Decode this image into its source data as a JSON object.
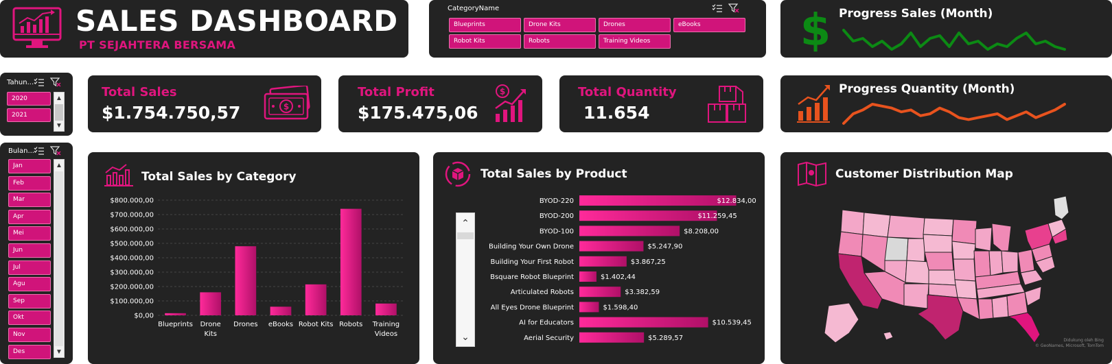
{
  "header": {
    "title": "SALES DASHBOARD",
    "subtitle": "PT SEJAHTERA BERSAMA"
  },
  "category_slicer": {
    "title": "CategoryName",
    "items": [
      "Blueprints",
      "Drone Kits",
      "Drones",
      "eBooks",
      "Robot Kits",
      "Robots",
      "Training Videos"
    ]
  },
  "year_slicer": {
    "title": "Tahun...",
    "items": [
      "2020",
      "2021"
    ]
  },
  "month_slicer": {
    "title": "Bulan...",
    "items": [
      "Jan",
      "Feb",
      "Mar",
      "Apr",
      "Mei",
      "Jun",
      "Jul",
      "Agu",
      "Sep",
      "Okt",
      "Nov",
      "Des"
    ]
  },
  "kpis": {
    "total_sales": {
      "label": "Total Sales",
      "value": "$1.754.750,57"
    },
    "total_profit": {
      "label": "Total Profit",
      "value": "$175.475,06"
    },
    "total_quantity": {
      "label": "Total Quantity",
      "value": "11.654"
    }
  },
  "progress_sales": {
    "title": "Progress Sales (Month)",
    "color": "#0c8a14",
    "values": [
      10,
      6,
      7,
      4,
      6,
      3,
      5,
      9,
      4,
      7,
      8,
      4,
      9,
      5,
      6,
      3,
      5,
      4,
      7,
      9,
      5,
      6,
      4,
      3
    ]
  },
  "progress_quantity": {
    "title": "Progress Quantity (Month)",
    "color": "#e8531e",
    "values": [
      5,
      10,
      12,
      15,
      14,
      13,
      11,
      12,
      9,
      10,
      13,
      11,
      8,
      7,
      8,
      9,
      10,
      7,
      9,
      11,
      8,
      10,
      12,
      15
    ]
  },
  "category_chart_title": "Total Sales by Category",
  "product_chart_title": "Total Sales by Product",
  "map": {
    "title": "Customer Distribution Map",
    "attribution_1": "Didukung oleh Bing",
    "attribution_2": "© GeoNames, Microsoft, TomTom"
  },
  "chart_data": [
    {
      "type": "bar",
      "title": "Total Sales by Category",
      "categories": [
        "Blueprints",
        "Drone Kits",
        "Drones",
        "eBooks",
        "Robot Kits",
        "Robots",
        "Training Videos"
      ],
      "category_lines": [
        [
          "Blueprints"
        ],
        [
          "Drone",
          "Kits"
        ],
        [
          "Drones"
        ],
        [
          "eBooks"
        ],
        [
          "Robot Kits"
        ],
        [
          "Robots"
        ],
        [
          "Training",
          "Videos"
        ]
      ],
      "values": [
        15000,
        160000,
        480000,
        60000,
        215000,
        740000,
        82000
      ],
      "ylim": [
        0,
        800000
      ],
      "yticks": [
        0,
        100000,
        200000,
        300000,
        400000,
        500000,
        600000,
        700000,
        800000
      ],
      "ytick_labels": [
        "$0,00",
        "$100.000,00",
        "$200.000,00",
        "$300.000,00",
        "$400.000,00",
        "$500.000,00",
        "$600.000,00",
        "$700.000,00",
        "$800.000,00"
      ],
      "grid": true,
      "color": "#e0157e"
    },
    {
      "type": "bar",
      "orientation": "horizontal",
      "title": "Total Sales by Product",
      "categories": [
        "BYOD-220",
        "BYOD-200",
        "BYOD-100",
        "Building Your Own Drone",
        "Building Your First Robot",
        "Bsquare Robot Blueprint",
        "Articulated Robots",
        "All Eyes Drone Blueprint",
        "AI for Educators",
        "Aerial Security"
      ],
      "values": [
        12834.0,
        11259.45,
        8208.0,
        5247.9,
        3867.25,
        1402.44,
        3382.59,
        1598.4,
        10539.45,
        5289.57
      ],
      "value_labels": [
        "$12.834,00",
        "$11.259,45",
        "$8.208,00",
        "$5.247,90",
        "$3.867,25",
        "$1.402,44",
        "$3.382,59",
        "$1.598,40",
        "$10.539,45",
        "$5.289,57"
      ],
      "xlim": [
        0,
        13200
      ],
      "color": "#e0157e"
    }
  ]
}
